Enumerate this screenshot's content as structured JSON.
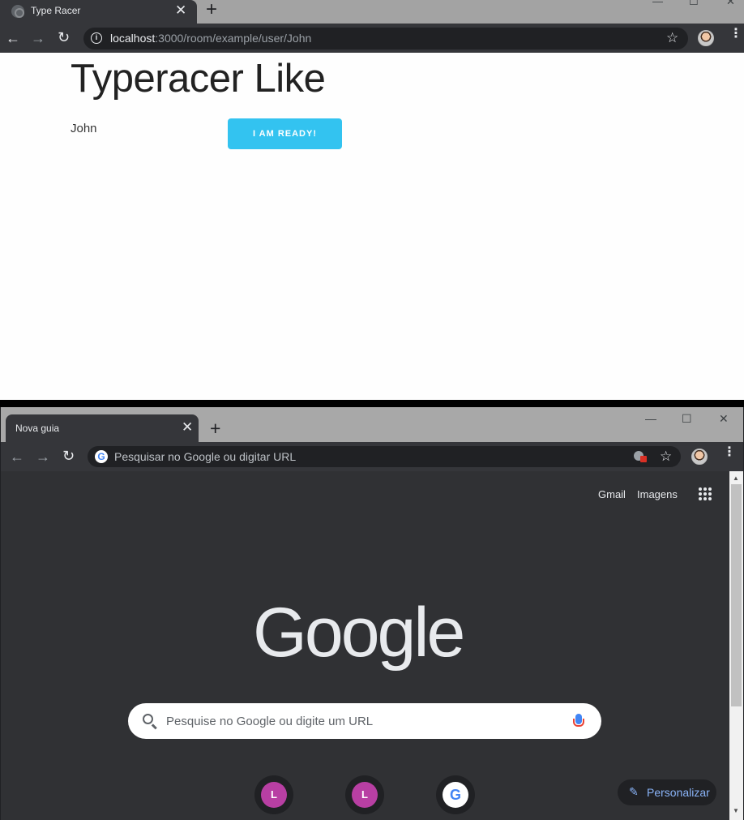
{
  "window1": {
    "tab": {
      "title": "Type Racer"
    },
    "address": {
      "host": "localhost",
      "path": ":3000/room/example/user/John"
    },
    "page": {
      "heading": "Typeracer Like",
      "username": "John",
      "ready_button": "I AM READY!"
    }
  },
  "window2": {
    "tab": {
      "title": "Nova guia"
    },
    "address": {
      "placeholder": "Pesquisar no Google ou digitar URL"
    },
    "ntp": {
      "links": [
        "Gmail",
        "Imagens"
      ],
      "logo": "Google",
      "search_placeholder": "Pesquise no Google ou digite um URL",
      "shortcuts": [
        "L",
        "L",
        "G"
      ],
      "customize_label": "Personalizar"
    }
  },
  "colors": {
    "accent": "#33c3f0",
    "chrome_dark": "#35363a",
    "shortcut_bg": "#b83fa3",
    "customize_text": "#8ab4f8"
  }
}
